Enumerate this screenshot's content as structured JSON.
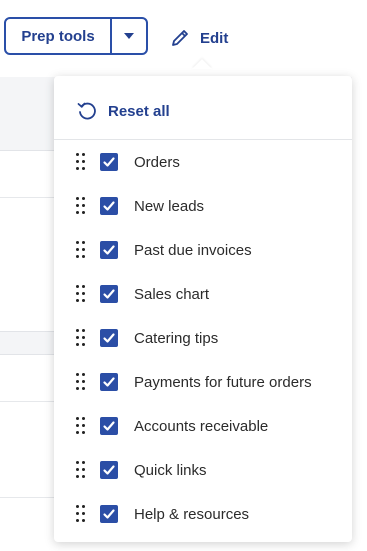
{
  "toolbar": {
    "prep_tools_label": "Prep tools",
    "edit_label": "Edit"
  },
  "dropdown": {
    "reset_label": "Reset all",
    "items": [
      {
        "label": "Orders",
        "checked": true
      },
      {
        "label": "New leads",
        "checked": true
      },
      {
        "label": "Past due invoices",
        "checked": true
      },
      {
        "label": "Sales chart",
        "checked": true
      },
      {
        "label": "Catering tips",
        "checked": true
      },
      {
        "label": "Payments for future orders",
        "checked": true
      },
      {
        "label": "Accounts receivable",
        "checked": true
      },
      {
        "label": "Quick links",
        "checked": true
      },
      {
        "label": "Help & resources",
        "checked": true
      }
    ]
  },
  "colors": {
    "accent": "#23408f",
    "checkbox": "#2b4ea6"
  },
  "icons": {
    "edit": "pencil-icon",
    "reset": "reset-icon",
    "caret": "chevron-down-icon",
    "drag": "drag-handle-icon",
    "check": "check-icon"
  }
}
